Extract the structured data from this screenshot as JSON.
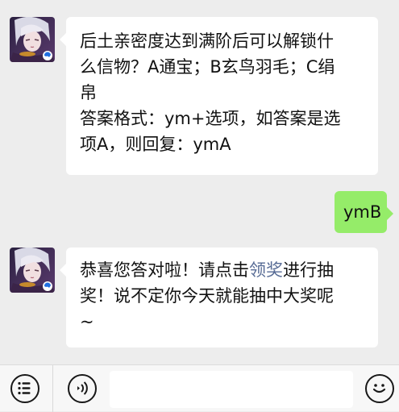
{
  "colors": {
    "chat_background": "#ededed",
    "incoming_bubble": "#ffffff",
    "outgoing_bubble": "#95ec69",
    "link": "#576b95",
    "input_bar": "#f7f7f7"
  },
  "messages": [
    {
      "sender": "official-account",
      "lines": [
        "后土亲密度达到满阶后可以解锁什",
        "么信物？A通宝；B玄鸟羽毛；C绢",
        "帛",
        "答案格式：ym+选项，如答案是选",
        "项A，则回复：ymA"
      ]
    },
    {
      "sender": "me",
      "text": "ymB"
    },
    {
      "sender": "official-account",
      "line1_before": "恭喜您答对啦！请点击",
      "line1_link": "领奖",
      "line1_after": "进行抽",
      "line2": "奖！说不定你今天就能抽中大奖呢",
      "line3": "~"
    }
  ],
  "input_bar": {
    "menu_icon": "menu-list-icon",
    "voice_icon": "voice-icon",
    "emoji_icon": "emoji-icon",
    "message_value": ""
  }
}
